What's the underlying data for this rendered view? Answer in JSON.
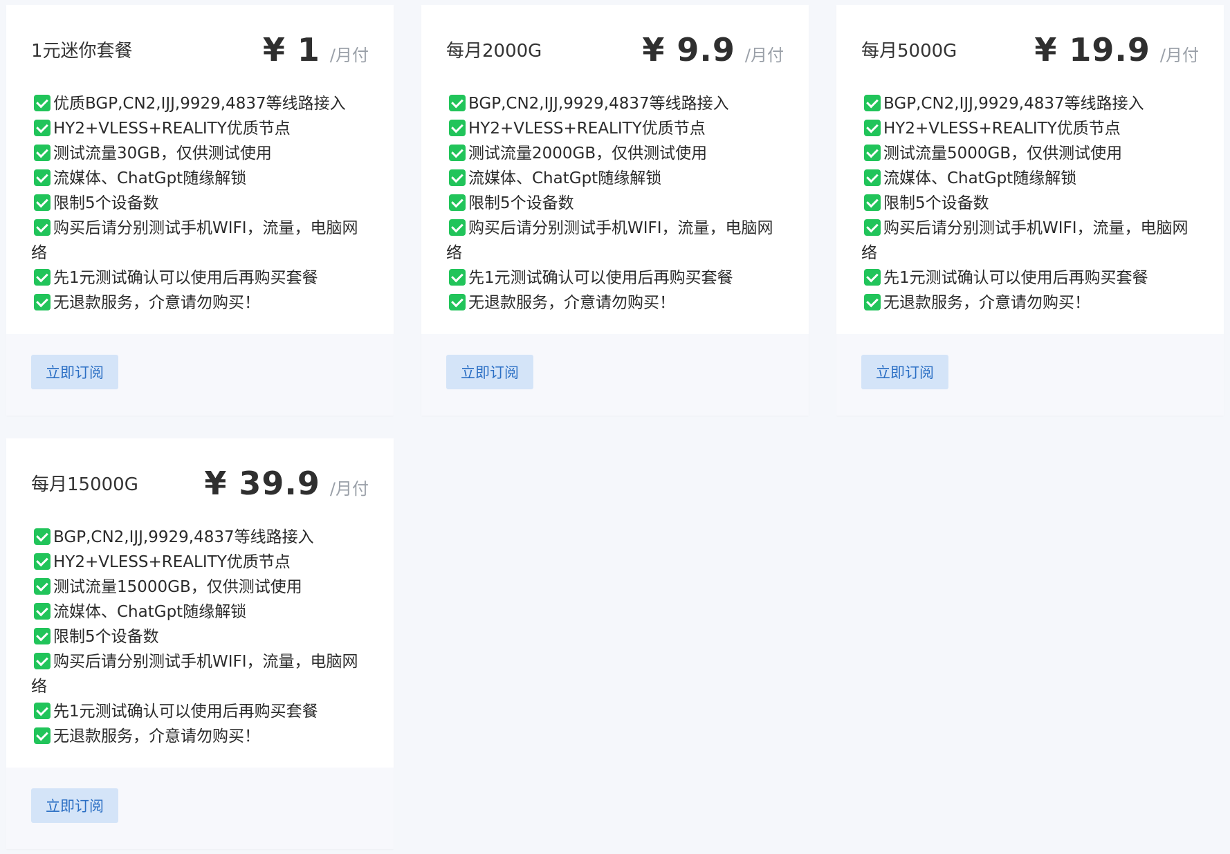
{
  "plans": [
    {
      "name": "1元迷你套餐",
      "price": "¥ 1",
      "unit": "/月付",
      "features": [
        "优质BGP,CN2,IJJ,9929,4837等线路接入",
        "HY2+VLESS+REALITY优质节点",
        "测试流量30GB，仅供测试使用",
        "流媒体、ChatGpt随缘解锁",
        "限制5个设备数",
        "购买后请分别测试手机WIFI，流量，电脑网络",
        "先1元测试确认可以使用后再购买套餐",
        "无退款服务，介意请勿购买！"
      ],
      "button": "立即订阅"
    },
    {
      "name": "每月2000G",
      "price": "¥ 9.9",
      "unit": "/月付",
      "features": [
        "BGP,CN2,IJJ,9929,4837等线路接入",
        "HY2+VLESS+REALITY优质节点",
        "测试流量2000GB，仅供测试使用",
        "流媒体、ChatGpt随缘解锁",
        "限制5个设备数",
        "购买后请分别测试手机WIFI，流量，电脑网络",
        "先1元测试确认可以使用后再购买套餐",
        "无退款服务，介意请勿购买！"
      ],
      "button": "立即订阅"
    },
    {
      "name": "每月5000G",
      "price": "¥ 19.9",
      "unit": "/月付",
      "features": [
        "BGP,CN2,IJJ,9929,4837等线路接入",
        "HY2+VLESS+REALITY优质节点",
        "测试流量5000GB，仅供测试使用",
        "流媒体、ChatGpt随缘解锁",
        "限制5个设备数",
        "购买后请分别测试手机WIFI，流量，电脑网络",
        "先1元测试确认可以使用后再购买套餐",
        "无退款服务，介意请勿购买！"
      ],
      "button": "立即订阅"
    },
    {
      "name": "每月15000G",
      "price": "¥ 39.9",
      "unit": "/月付",
      "features": [
        "BGP,CN2,IJJ,9929,4837等线路接入",
        "HY2+VLESS+REALITY优质节点",
        "测试流量15000GB，仅供测试使用",
        "流媒体、ChatGpt随缘解锁",
        "限制5个设备数",
        "购买后请分别测试手机WIFI，流量，电脑网络",
        "先1元测试确认可以使用后再购买套餐",
        "无退款服务，介意请勿购买！"
      ],
      "button": "立即订阅"
    }
  ],
  "colors": {
    "check": "#21c45a",
    "button_bg": "#d4e4f8",
    "button_text": "#2b6fc4",
    "page_bg": "#f5f7fb"
  },
  "icons": {
    "feature_icon": "check-box-icon"
  }
}
